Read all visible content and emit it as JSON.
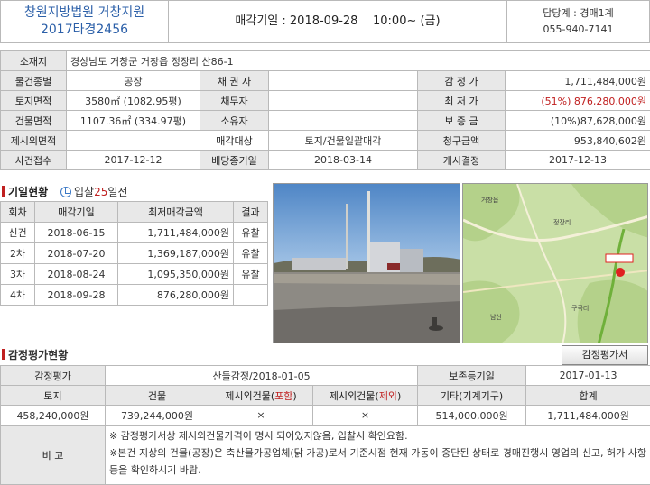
{
  "header": {
    "court": "창원지방법원 거창지원",
    "case_no": "2017타경2456",
    "sale_label": "매각기일",
    "sale_date": "2018-09-28",
    "sale_time": "10:00~ (금)",
    "dept": "담당계 : 경매1계",
    "phone": "055-940-7141"
  },
  "info": {
    "address_label": "소재지",
    "address": "경상남도 거창군 거창읍 정장리 산86-1",
    "type_label": "물건종별",
    "type": "공장",
    "creditor_label": "채 권 자",
    "creditor": "",
    "appraisal_label": "감 정 가",
    "appraisal": "1,711,484,000원",
    "land_label": "토지면적",
    "land": "3580㎡ (1082.95평)",
    "debtor_label": "채무자",
    "debtor": "",
    "min_label": "최 저 가",
    "min_rate": "(51%)",
    "min_price": "876,280,000원",
    "building_label": "건물면적",
    "building": "1107.36㎡ (334.97평)",
    "owner_label": "소유자",
    "owner": "",
    "deposit_label": "보 증 금",
    "deposit": "(10%)87,628,000원",
    "excluded_label": "제시외면적",
    "excluded": "",
    "sale_target_label": "매각대상",
    "sale_target": "토지/건물일괄매각",
    "claim_label": "청구금액",
    "claim": "953,840,602원",
    "receipt_label": "사건접수",
    "receipt": "2017-12-12",
    "dividend_label": "배당종기일",
    "dividend": "2018-03-14",
    "start_label": "개시결정",
    "start": "2017-12-13"
  },
  "history": {
    "title": "기일현황",
    "bid_prefix": "입찰",
    "bid_days": "25",
    "bid_suffix": "일전",
    "headers": [
      "회차",
      "매각기일",
      "최저매각금액",
      "결과"
    ],
    "rows": [
      {
        "round": "신건",
        "date": "2018-06-15",
        "price": "1,711,484,000원",
        "result": "유찰"
      },
      {
        "round": "2차",
        "date": "2018-07-20",
        "price": "1,369,187,000원",
        "result": "유찰"
      },
      {
        "round": "3차",
        "date": "2018-08-24",
        "price": "1,095,350,000원",
        "result": "유찰"
      },
      {
        "round": "4차",
        "date": "2018-09-28",
        "price": "876,280,000원",
        "result": ""
      }
    ]
  },
  "map": {
    "labels": [
      "거창읍",
      "정장리",
      "남산",
      "구곡리"
    ]
  },
  "appraisal": {
    "title": "감정평가현황",
    "button": "감정평가서",
    "appraisal_label": "감정평가",
    "appraisal_value": "산들감정/2018-01-05",
    "preserve_label": "보존등기일",
    "preserve_value": "2017-01-13",
    "headers": {
      "land": "토지",
      "building": "건물",
      "ext_in_a": "제시외건물(",
      "ext_in_b": "포함",
      "ext_in_c": ")",
      "ext_out_a": "제시외건물(",
      "ext_out_b": "제외",
      "ext_out_c": ")",
      "other": "기타(기계기구)",
      "total": "합계"
    },
    "values": {
      "land": "458,240,000원",
      "building": "739,244,000원",
      "ext_in": "×",
      "ext_out": "×",
      "other": "514,000,000원",
      "total": "1,711,484,000원"
    },
    "note_label": "비 고",
    "note_1": "※ 감정평가서상 제시외건물가격이 명시 되어있지않음, 입찰시 확인요함.",
    "note_2": "※본건 지상의 건물(공장)은 축산물가공업체(닭 가공)로서 기준시점 현재 가동이 중단된 상태로 경매진행시 영업의 신고, 허가 사항 등을 확인하시기 바람."
  },
  "colors": {
    "accent_blue": "#2b5fa8",
    "accent_red": "#c02020",
    "label_bg": "#e8e8e8"
  }
}
